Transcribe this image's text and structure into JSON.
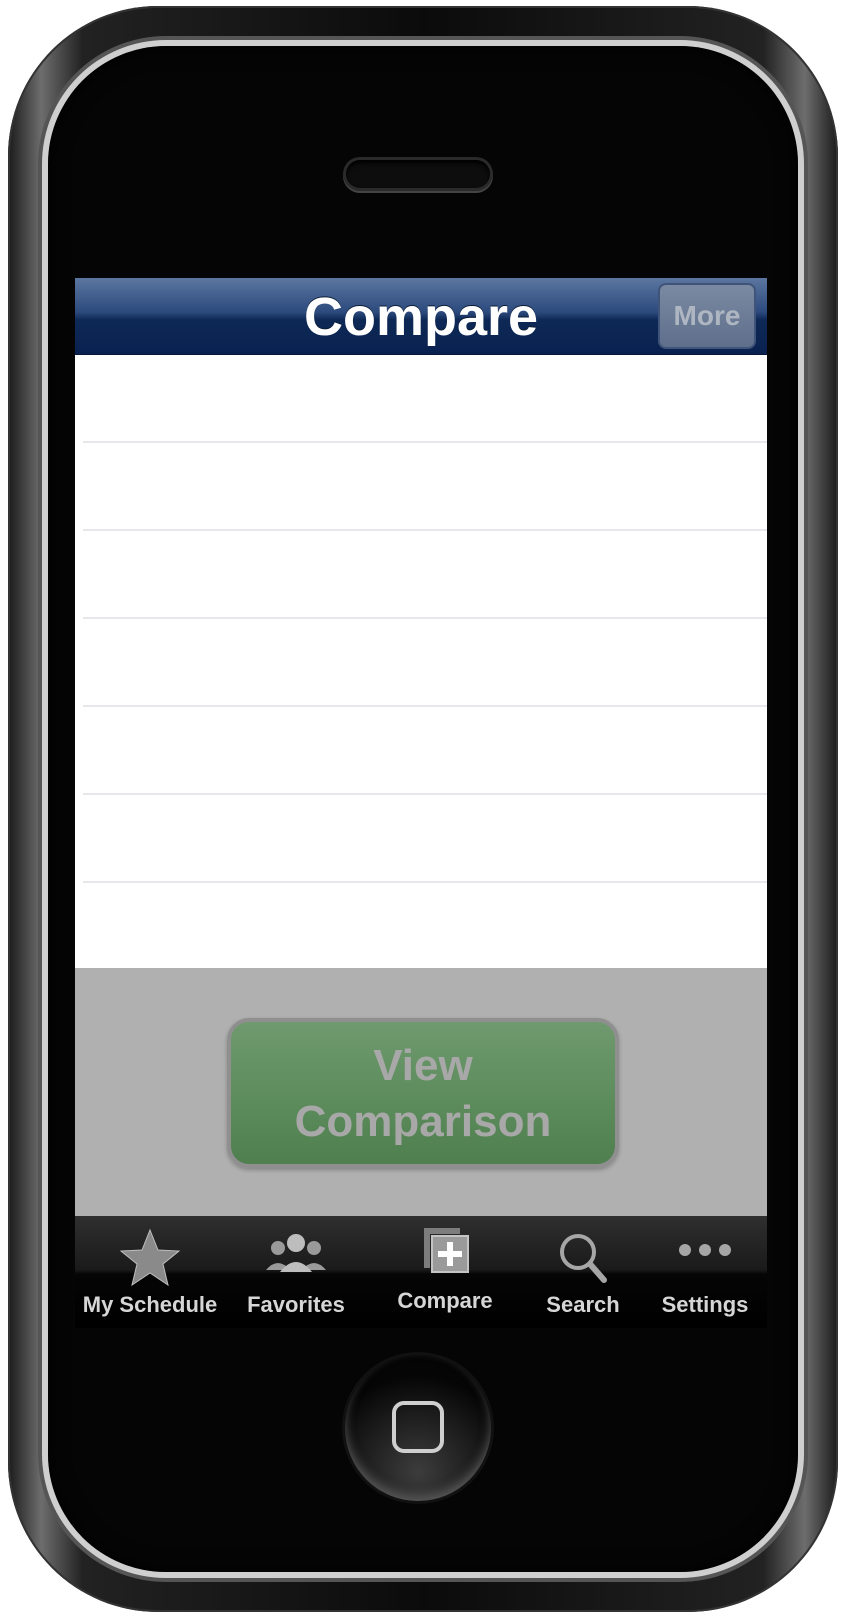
{
  "navbar": {
    "title": "Compare",
    "more_label": "More"
  },
  "list": {
    "rows": [
      "",
      "",
      "",
      "",
      "",
      "",
      ""
    ]
  },
  "overlay": {
    "button_line1": "View",
    "button_line2": "Comparison",
    "button_color": "#5e8d5e"
  },
  "tabbar": {
    "tabs": [
      {
        "label": "My Schedule",
        "icon": "star-icon"
      },
      {
        "label": "Favorites",
        "icon": "people-icon"
      },
      {
        "label": "Compare",
        "icon": "compare-icon"
      },
      {
        "label": "Search",
        "icon": "search-icon"
      },
      {
        "label": "Settings",
        "icon": "ellipsis-icon"
      }
    ]
  },
  "colors": {
    "navbar": "#0e2956",
    "overlay": "#b0b0b0",
    "tabbar": "#000000"
  }
}
